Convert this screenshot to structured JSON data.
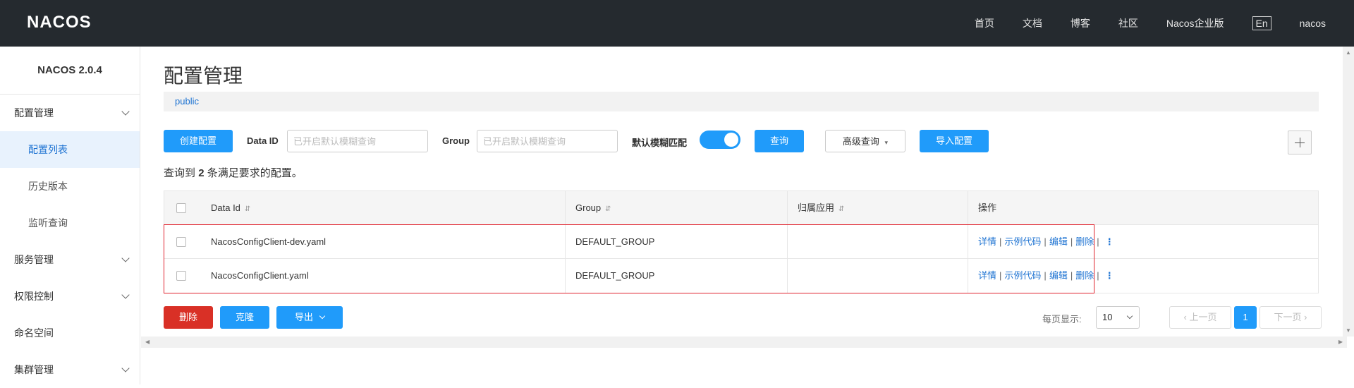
{
  "topbar": {
    "logo": "NACOS",
    "nav": [
      "首页",
      "文档",
      "博客",
      "社区",
      "Nacos企业版",
      "En",
      "nacos"
    ]
  },
  "sidebar": {
    "version": "NACOS 2.0.4",
    "items": [
      {
        "label": "配置管理",
        "expandable": true
      },
      {
        "label": "配置列表",
        "sub": true,
        "active": true
      },
      {
        "label": "历史版本",
        "sub": true
      },
      {
        "label": "监听查询",
        "sub": true
      },
      {
        "label": "服务管理",
        "expandable": true
      },
      {
        "label": "权限控制",
        "expandable": true
      },
      {
        "label": "命名空间"
      },
      {
        "label": "集群管理",
        "expandable": true
      }
    ]
  },
  "main": {
    "title": "配置管理",
    "namespace": "public",
    "toolbar": {
      "create": "创建配置",
      "dataid_label": "Data ID",
      "dataid_placeholder": "已开启默认模糊查询",
      "group_label": "Group",
      "group_placeholder": "已开启默认模糊查询",
      "fuzzy_label": "默认模糊匹配",
      "fuzzy_on": true,
      "query": "查询",
      "advanced": "高级查询",
      "import": "导入配置"
    },
    "result": {
      "prefix": "查询到",
      "count": "2",
      "suffix": "条满足要求的配置。"
    },
    "table": {
      "headers": [
        "Data Id",
        "Group",
        "归属应用",
        "操作"
      ],
      "rows": [
        {
          "dataid": "NacosConfigClient-dev.yaml",
          "group": "DEFAULT_GROUP",
          "app": ""
        },
        {
          "dataid": "NacosConfigClient.yaml",
          "group": "DEFAULT_GROUP",
          "app": ""
        }
      ],
      "ops": [
        "详情",
        "示例代码",
        "编辑",
        "删除"
      ],
      "sep": "|",
      "more": "⋮"
    },
    "footer": {
      "delete": "删除",
      "clone": "克隆",
      "export": "导出",
      "page_size_label": "每页显示:",
      "page_size": "10",
      "prev": "上一页",
      "current_page": "1",
      "next": "下一页"
    }
  },
  "colors": {
    "primary": "#209bfa",
    "danger": "#d93026",
    "topbar": "#252a2f",
    "link": "#1e73d2",
    "highlight_frame": "#e0242e"
  }
}
